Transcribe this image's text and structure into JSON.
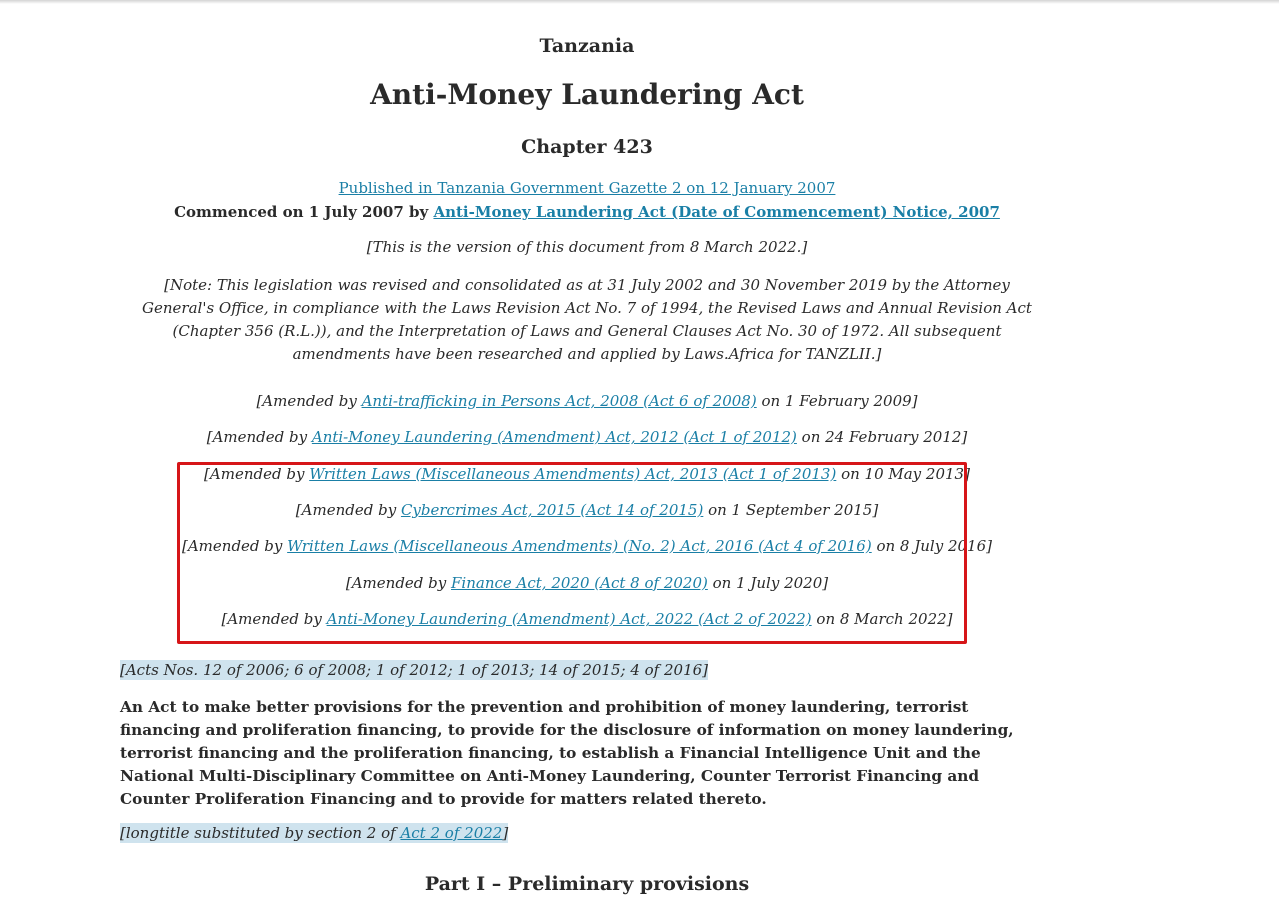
{
  "header": {
    "country": "Tanzania",
    "title": "Anti-Money Laundering Act",
    "chapter": "Chapter 423"
  },
  "publication": {
    "published_link": "Published in Tanzania Government Gazette 2 on 12 January 2007",
    "commenced_prefix": "Commenced on 1 July 2007 by ",
    "commenced_link": "Anti-Money Laundering Act (Date of Commencement) Notice, 2007"
  },
  "version_note": "[This is the version of this document from 8 March 2022.]",
  "revision_note": "[Note: This legislation was revised and consolidated as at 31 July 2002 and 30 November 2019 by the Attorney General's Office, in compliance with the Laws Revision Act No. 7 of 1994, the Revised Laws and Annual Revision Act (Chapter 356 (R.L.)), and the Interpretation of Laws and General Clauses Act No. 30 of 1972. All subsequent amendments have been researched and applied by Laws.Africa for TANZLII.]",
  "amendments": [
    {
      "prefix": "[Amended by ",
      "link": "Anti-trafficking in Persons Act, 2008 (Act 6 of 2008)",
      "suffix": " on 1 February 2009]"
    },
    {
      "prefix": "[Amended by ",
      "link": "Anti-Money Laundering (Amendment) Act, 2012 (Act 1 of 2012)",
      "suffix": " on 24 February 2012]"
    },
    {
      "prefix": "[Amended by ",
      "link": "Written Laws (Miscellaneous Amendments) Act, 2013 (Act 1 of 2013)",
      "suffix": " on 10 May 2013]"
    },
    {
      "prefix": "[Amended by ",
      "link": "Cybercrimes Act, 2015 (Act 14 of 2015)",
      "suffix": " on 1 September 2015]"
    },
    {
      "prefix": "[Amended by ",
      "link": "Written Laws (Miscellaneous Amendments) (No. 2) Act, 2016 (Act 4 of 2016)",
      "suffix": " on 8 July 2016]"
    },
    {
      "prefix": "[Amended by ",
      "link": "Finance Act, 2020 (Act 8 of 2020)",
      "suffix": " on 1 July 2020]"
    },
    {
      "prefix": "[Amended by ",
      "link": "Anti-Money Laundering (Amendment) Act, 2022 (Act 2 of 2022)",
      "suffix": " on 8 March 2022]"
    }
  ],
  "acts_nos": "[Acts Nos. 12 of 2006; 6 of 2008; 1 of 2012; 1 of 2013; 14 of 2015; 4 of 2016]",
  "long_title": "An Act to make better provisions for the prevention and prohibition of money laundering, terrorist financing and proliferation financing, to provide for the disclosure of information on money laundering, terrorist financing and the proliferation financing, to establish a Financial Intelligence Unit and the National Multi-Disciplinary Committee on Anti-Money Laundering, Counter Terrorist Financing and Counter Proliferation Financing and to provide for matters related thereto.",
  "longtitle_note": {
    "prefix": "[longtitle substituted by section 2 of ",
    "link": "Act 2 of 2022",
    "suffix": "]"
  },
  "part_heading": "Part I – Preliminary provisions",
  "colors": {
    "link": "#1a7fa6",
    "highlight_box": "#d61518",
    "text_highlight": "#cfe3ee"
  }
}
